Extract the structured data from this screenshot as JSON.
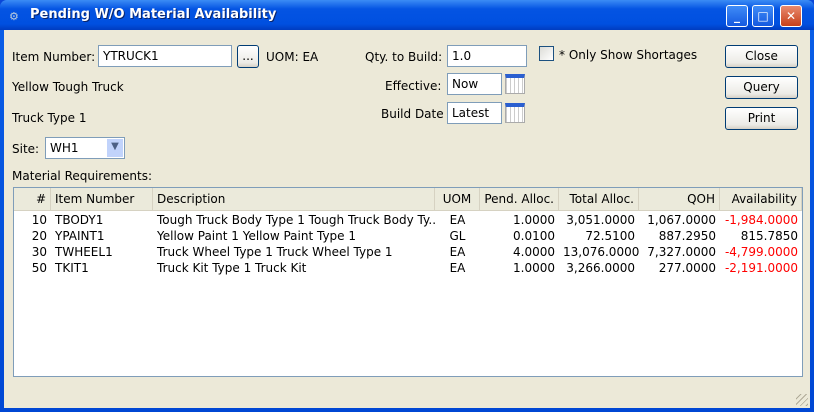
{
  "window": {
    "title": "Pending W/O Material Availability",
    "minimize": "_",
    "maximize": "□",
    "close": "✕"
  },
  "form": {
    "item_number_label": "Item Number:",
    "item_number": "YTRUCK1",
    "lookup": "...",
    "uom": "UOM: EA",
    "description1": "Yellow Tough Truck",
    "description2": "Truck Type 1",
    "site_label": "Site:",
    "site": "WH1",
    "qty_label": "Qty. to Build:",
    "qty": "1.0",
    "effective_label": "Effective:",
    "effective": "Now",
    "build_date_label": "Build Date",
    "build_date": "Latest",
    "shortages_label": "Only Show Shortages",
    "shortages_checked": false
  },
  "buttons": {
    "close": "Close",
    "query": "Query",
    "print": "Print"
  },
  "table": {
    "label": "Material Requirements:",
    "columns": [
      "#",
      "Item Number",
      "Description",
      "UOM",
      "Pend. Alloc.",
      "Total Alloc.",
      "QOH",
      "Availability"
    ],
    "rows": [
      [
        "10",
        "TBODY1",
        "Tough Truck Body Type 1 Tough Truck Body Ty...",
        "EA",
        "1.0000",
        "3,051.0000",
        "1,067.0000",
        "-1,984.0000"
      ],
      [
        "20",
        "YPAINT1",
        "Yellow Paint 1  Yellow Paint Type 1",
        "GL",
        "0.0100",
        "72.5100",
        "887.2950",
        "815.7850"
      ],
      [
        "30",
        "TWHEEL1",
        "Truck Wheel Type 1 Truck Wheel Type 1",
        "EA",
        "4.0000",
        "13,076.0000",
        "7,327.0000",
        "-4,799.0000"
      ],
      [
        "50",
        "TKIT1",
        "Truck Kit Type 1 Truck Kit",
        "EA",
        "1.0000",
        "3,266.0000",
        "277.0000",
        "-2,191.0000"
      ]
    ]
  },
  "colors": {
    "negative": "#ff0000",
    "title_bar": "#0050e0"
  }
}
